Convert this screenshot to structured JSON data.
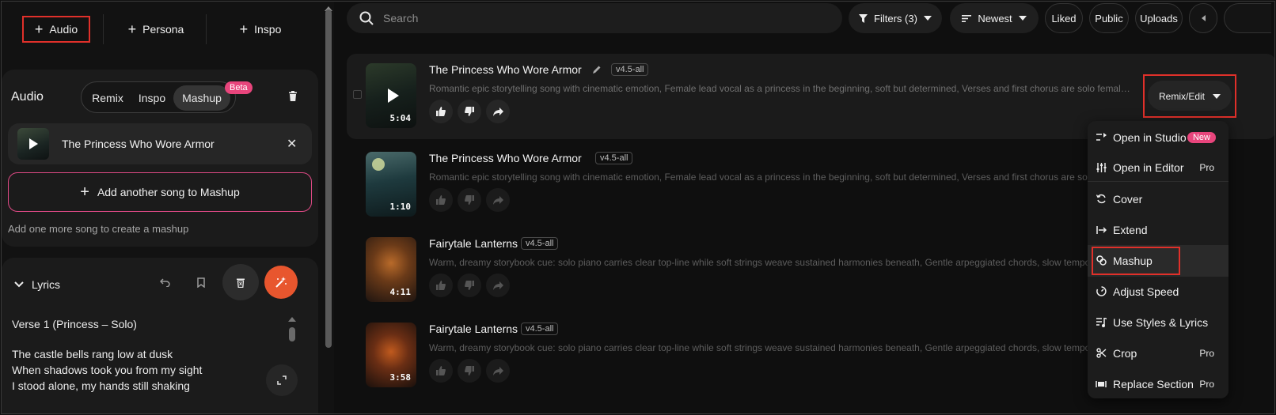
{
  "left": {
    "top_tabs": [
      {
        "label": "Audio"
      },
      {
        "label": "Persona"
      },
      {
        "label": "Inspo"
      }
    ],
    "audio_section": {
      "title": "Audio",
      "modes": [
        {
          "label": "Remix"
        },
        {
          "label": "Inspo"
        },
        {
          "label": "Mashup"
        }
      ],
      "beta_badge": "Beta",
      "selected_song": "The Princess Who Wore Armor",
      "add_song_label": "Add another song to Mashup",
      "hint": "Add one more song to create a mashup"
    },
    "lyrics": {
      "title": "Lyrics",
      "verse_label": "Verse 1 (Princess – Solo)",
      "lines": [
        "The castle bells rang low at dusk",
        "When shadows took you from my sight",
        "I stood alone, my hands still shaking"
      ]
    }
  },
  "right": {
    "search_placeholder": "Search",
    "filters_label": "Filters (3)",
    "sort_label": "Newest",
    "filter_pills": [
      "Liked",
      "Public",
      "Uploads"
    ],
    "songs": [
      {
        "title": "The Princess Who Wore Armor",
        "version": "v4.5-all",
        "duration": "5:04",
        "description": "Romantic epic storytelling song with cinematic emotion, Female lead vocal as a princess in the beginning, soft but determined, Verses and first chorus are solo female vocals, From..."
      },
      {
        "title": "The Princess Who Wore Armor",
        "version": "v4.5-all",
        "duration": "1:10",
        "description": "Romantic epic storytelling song with cinematic emotion, Female lead vocal as a princess in the beginning, soft but determined, Verses and first chorus are solo female vocals, From..."
      },
      {
        "title": "Fairytale Lanterns",
        "version": "v4.5-all",
        "duration": "4:11",
        "description": "Warm, dreamy storybook cue: solo piano carries clear top-line while soft strings weave sustained harmonies beneath, Gentle arpeggiated chords, slow tempo, wide voicings"
      },
      {
        "title": "Fairytale Lanterns",
        "version": "v4.5-all",
        "duration": "3:58",
        "description": "Warm, dreamy storybook cue: solo piano carries clear top-line while soft strings weave sustained harmonies beneath, Gentle arpeggiated chords, slow tempo, wide voicings"
      }
    ],
    "remix_button": "Remix/Edit",
    "menu": [
      {
        "label": "Open in Studio",
        "tag": "New"
      },
      {
        "label": "Open in Editor",
        "tag": "Pro"
      },
      {
        "label": "Cover",
        "tag": ""
      },
      {
        "label": "Extend",
        "tag": ""
      },
      {
        "label": "Mashup",
        "tag": ""
      },
      {
        "label": "Adjust Speed",
        "tag": ""
      },
      {
        "label": "Use Styles & Lyrics",
        "tag": ""
      },
      {
        "label": "Crop",
        "tag": "Pro"
      },
      {
        "label": "Replace Section",
        "tag": "Pro"
      }
    ]
  },
  "colors": {
    "highlight": "#e0302a",
    "accent_pink": "#e8457c",
    "magic_orange": "#e8562e"
  }
}
